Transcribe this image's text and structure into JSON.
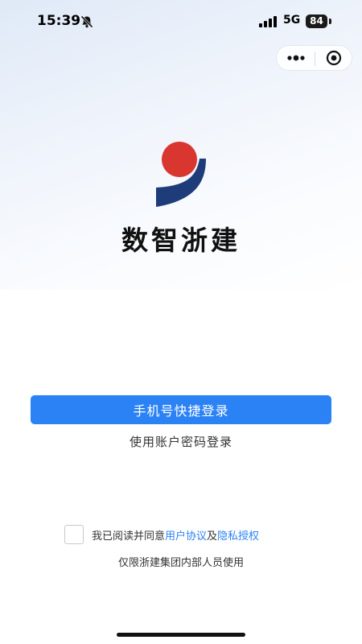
{
  "status_bar": {
    "time": "15:39",
    "network": "5G",
    "battery": "84"
  },
  "icons": {
    "bell": "bell-muted-icon",
    "signal": "signal-icon",
    "more": "more-dots-icon",
    "close": "close-circle-icon",
    "logo": "logo-icon"
  },
  "brand": {
    "name": "数智浙建",
    "colors": {
      "logo_red": "#d8362f",
      "logo_navy": "#1f3c7a"
    }
  },
  "login": {
    "phone_button": "手机号快捷登录",
    "password_link": "使用账户密码登录"
  },
  "agreement": {
    "prefix": "我已阅读并同意",
    "user_agreement": "用户协议",
    "and": "及",
    "privacy": "隐私授权",
    "checked": false
  },
  "notice": "仅限浙建集团内部人员使用",
  "colors": {
    "primary": "#2b82f5",
    "link": "#2b82f5"
  }
}
